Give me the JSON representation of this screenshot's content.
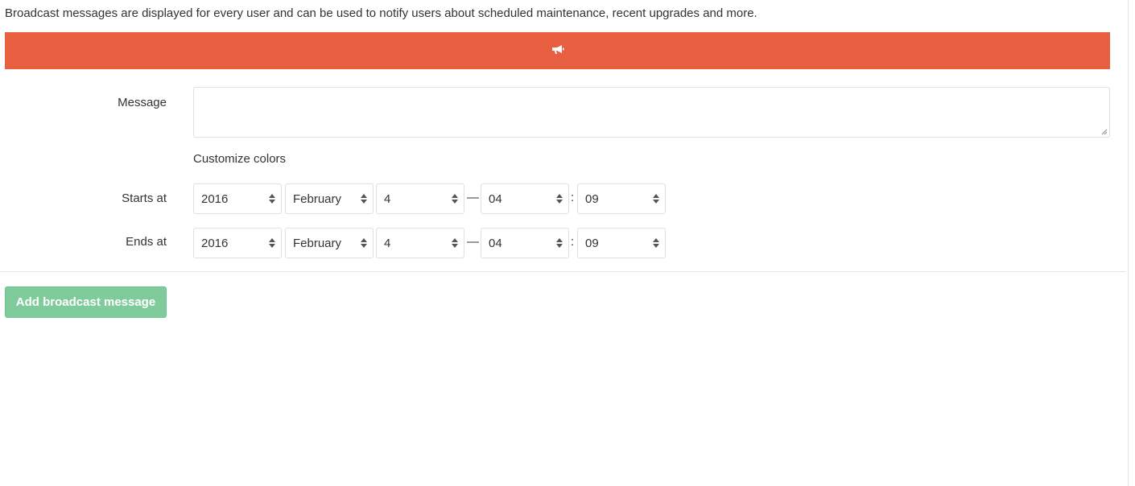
{
  "intro_text": "Broadcast messages are displayed for every user and can be used to notify users about scheduled maintenance, recent upgrades and more.",
  "preview": {
    "icon": "bullhorn-icon",
    "color": "#e75e40"
  },
  "form": {
    "message_label": "Message",
    "message_value": "",
    "customize_colors": "Customize colors",
    "starts": {
      "label": "Starts at",
      "year": "2016",
      "month": "February",
      "day": "4",
      "dash": "—",
      "hour": "04",
      "colon": ":",
      "minute": "09"
    },
    "ends": {
      "label": "Ends at",
      "year": "2016",
      "month": "February",
      "day": "4",
      "dash": "—",
      "hour": "04",
      "colon": ":",
      "minute": "09"
    }
  },
  "submit": {
    "label": "Add broadcast message",
    "color": "#7fcb9c"
  }
}
